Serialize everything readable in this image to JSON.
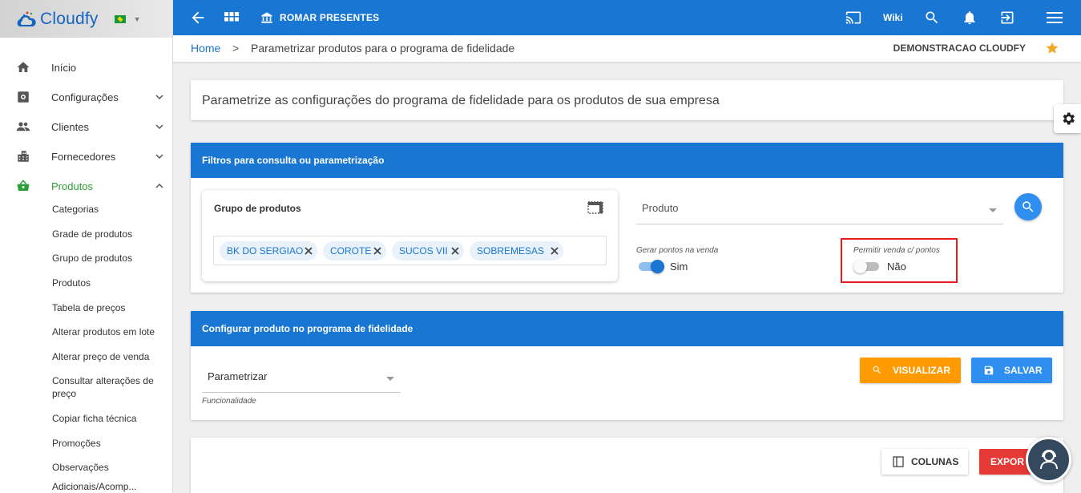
{
  "brand": {
    "name": "Cloudfy",
    "flag_icon": "brazil-flag-icon"
  },
  "sidebar": {
    "items": [
      {
        "label": "Início",
        "icon": "home-icon"
      },
      {
        "label": "Configurações",
        "icon": "settings-box-icon"
      },
      {
        "label": "Clientes",
        "icon": "people-icon"
      },
      {
        "label": "Fornecedores",
        "icon": "building-icon"
      },
      {
        "label": "Produtos",
        "icon": "basket-icon"
      }
    ],
    "subitems": [
      "Categorias",
      "Grade de produtos",
      "Grupo de produtos",
      "Produtos",
      "Tabela de preços",
      "Alterar produtos em lote",
      "Alterar preço de venda",
      "Consultar alterações de preço",
      "Copiar ficha técnica",
      "Promoções",
      "Observações",
      "Adicionais/Acomp..."
    ]
  },
  "header": {
    "company": "ROMAR PRESENTES",
    "wiki": "Wiki"
  },
  "breadcrumb": {
    "home": "Home",
    "separator": ">",
    "current": "Parametrizar produtos para o programa de fidelidade",
    "company_name": "DEMONSTRACAO CLOUDFY"
  },
  "intro": {
    "text": "Parametrize as configurações do programa de fidelidade para os produtos de sua empresa"
  },
  "filters": {
    "title": "Filtros para consulta ou parametrização",
    "group_title": "Grupo de produtos",
    "chips": [
      "BK DO SERGIAO",
      "COROTE",
      "SUCOS VII",
      "SOBREMESAS"
    ],
    "produto_label": "Produto",
    "gerar_pontos": {
      "label": "Gerar pontos na venda",
      "value": "Sim",
      "on": true
    },
    "permitir_venda": {
      "label": "Permitir venda c/ pontos",
      "value": "Não",
      "on": false
    }
  },
  "config": {
    "title": "Configurar produto no programa de fidelidade",
    "funcionalidade_value": "Parametrizar",
    "funcionalidade_hint": "Funcionalidade",
    "visualizar_label": "VISUALIZAR",
    "salvar_label": "SALVAR"
  },
  "results": {
    "colunas_label": "COLUNAS",
    "export_label": "EXPOR"
  },
  "colors": {
    "primary": "#1976d2",
    "accent_green": "#2e9e36",
    "orange": "#ff9b00",
    "red": "#e53935",
    "highlight": "#e51c1c"
  }
}
